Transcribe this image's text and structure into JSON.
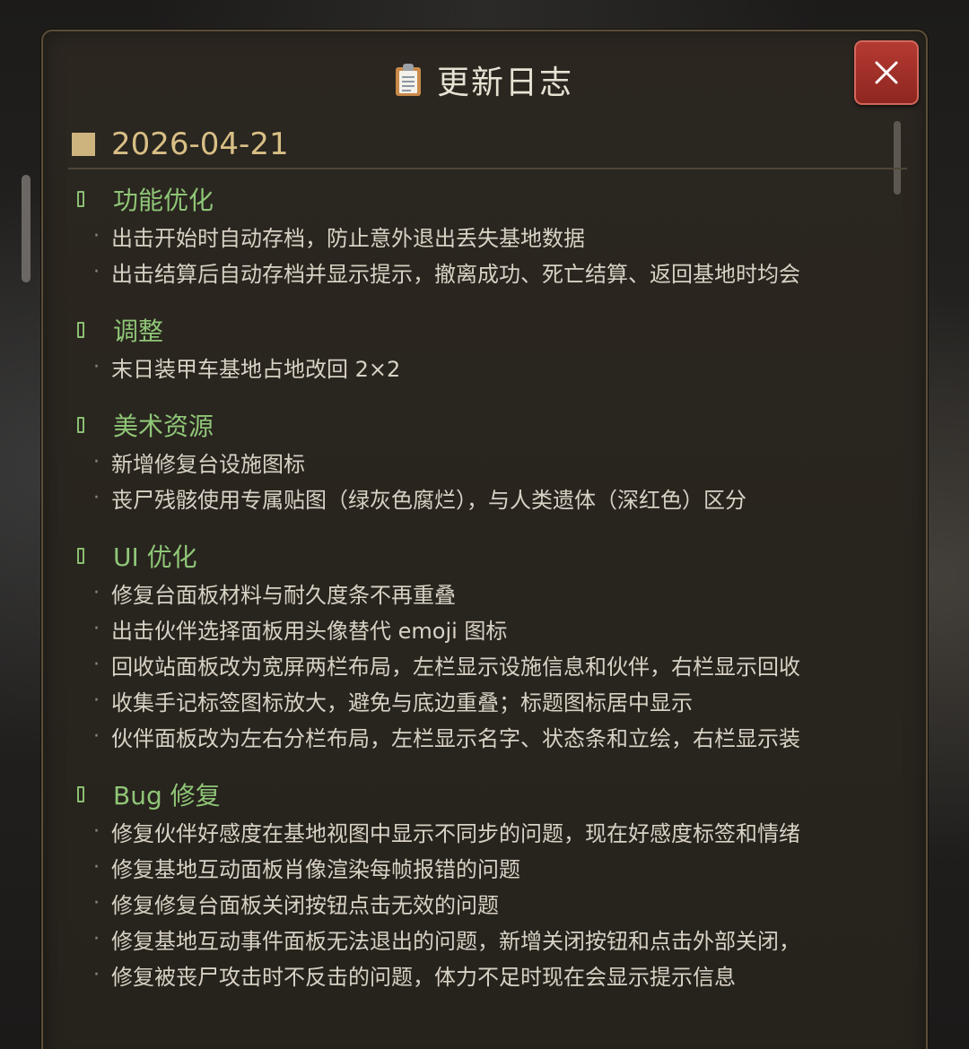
{
  "dialog": {
    "title": "更新日志",
    "title_icon": "clipboard-icon",
    "close_icon": "close-icon"
  },
  "changelog": {
    "date": "2026-04-21",
    "sections": [
      {
        "title": "功能优化",
        "items": [
          "出击开始时自动存档，防止意外退出丢失基地数据",
          "出击结算后自动存档并显示提示，撤离成功、死亡结算、返回基地时均会"
        ]
      },
      {
        "title": "调整",
        "items": [
          "末日装甲车基地占地改回 2×2"
        ]
      },
      {
        "title": "美术资源",
        "items": [
          "新增修复台设施图标",
          "丧尸残骸使用专属贴图（绿灰色腐烂），与人类遗体（深红色）区分"
        ]
      },
      {
        "title": "UI 优化",
        "items": [
          "修复台面板材料与耐久度条不再重叠",
          "出击伙伴选择面板用头像替代 emoji 图标",
          "回收站面板改为宽屏两栏布局，左栏显示设施信息和伙伴，右栏显示回收",
          "收集手记标签图标放大，避免与底边重叠；标题图标居中显示",
          "伙伴面板改为左右分栏布局，左栏显示名字、状态条和立绘，右栏显示装"
        ]
      },
      {
        "title": "Bug 修复",
        "items": [
          "修复伙伴好感度在基地视图中显示不同步的问题，现在好感度标签和情绪",
          "修复基地互动面板肖像渲染每帧报错的问题",
          "修复修复台面板关闭按钮点击无效的问题",
          "修复基地互动事件面板无法退出的问题，新增关闭按钮和点击外部关闭，",
          "修复被丧尸攻击时不反击的问题，体力不足时现在会显示提示信息"
        ]
      }
    ]
  },
  "colors": {
    "accent_date": "#d8bf85",
    "section_title": "#8fc677",
    "item_text": "#d8d2c5",
    "close_button": "#a8322b",
    "panel_border": "#5b4e38"
  }
}
